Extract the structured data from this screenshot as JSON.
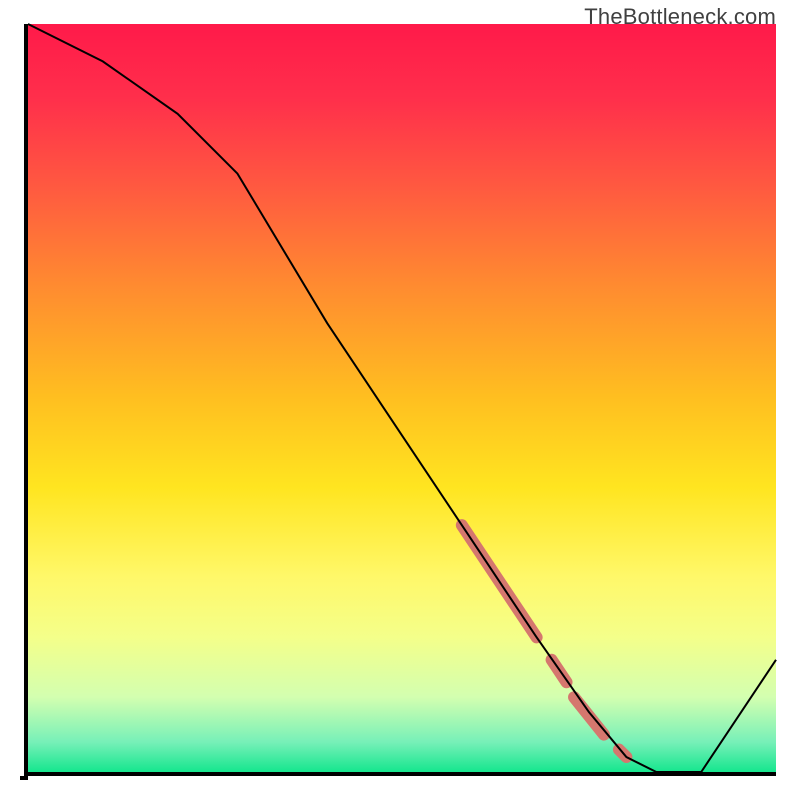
{
  "watermark": "TheBottleneck.com",
  "chart_data": {
    "type": "line",
    "title": "",
    "xlabel": "",
    "ylabel": "",
    "xlim": [
      0,
      100
    ],
    "ylim": [
      0,
      100
    ],
    "grid": false,
    "legend": false,
    "series": [
      {
        "name": "bottleneck-curve",
        "x": [
          0,
          10,
          20,
          28,
          40,
          50,
          60,
          68,
          75,
          80,
          84,
          90,
          100
        ],
        "y": [
          100,
          95,
          88,
          80,
          60,
          45,
          30,
          18,
          8,
          2,
          0,
          0,
          15
        ],
        "color": "#000000"
      }
    ],
    "highlight_segments": [
      {
        "name": "thick-band",
        "x0": 58,
        "y0": 33,
        "x1": 68,
        "y1": 18,
        "color": "#d5776e",
        "width": 12
      },
      {
        "name": "gap-thin",
        "x0": 70,
        "y0": 15,
        "x1": 72,
        "y1": 12,
        "color": "#d5776e",
        "width": 12
      },
      {
        "name": "lower-thick",
        "x0": 73,
        "y0": 10,
        "x1": 77,
        "y1": 5,
        "color": "#d5776e",
        "width": 12
      },
      {
        "name": "tip-dot",
        "x0": 79,
        "y0": 3,
        "x1": 80,
        "y1": 2,
        "color": "#d5776e",
        "width": 12
      }
    ],
    "background_gradient": {
      "top": "#ff1a4a",
      "mid": "#ffe520",
      "bottom": "#15e68e"
    }
  }
}
